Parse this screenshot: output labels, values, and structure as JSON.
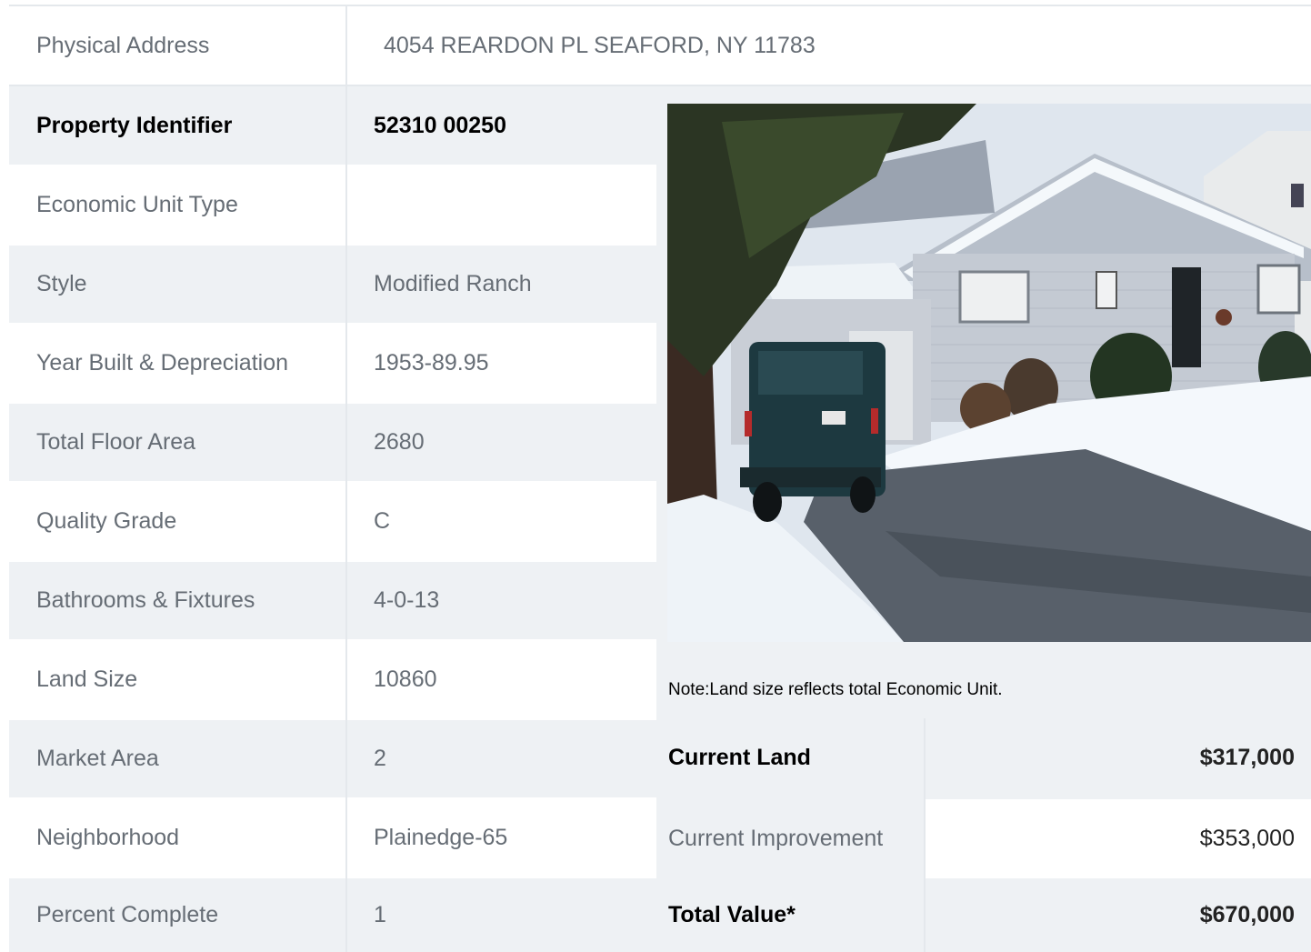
{
  "header": {
    "label": "Physical Address",
    "value": "4054  REARDON PL  SEAFORD, NY  11783"
  },
  "rows": [
    {
      "label": "Property Identifier",
      "value": "52310  00250",
      "bold": true
    },
    {
      "label": "Economic Unit Type",
      "value": ""
    },
    {
      "label": "Style",
      "value": "Modified Ranch"
    },
    {
      "label": "Year Built & Depreciation",
      "value": "1953-89.95"
    },
    {
      "label": "Total Floor Area",
      "value": "2680"
    },
    {
      "label": "Quality Grade",
      "value": "C"
    },
    {
      "label": "Bathrooms & Fixtures",
      "value": "4-0-13"
    },
    {
      "label": "Land Size",
      "value": "10860"
    },
    {
      "label": "Market Area",
      "value": "2"
    },
    {
      "label": "Neighborhood",
      "value": "Plainedge-65"
    },
    {
      "label": "Percent Complete",
      "value": "1"
    }
  ],
  "note": "Note:Land size reflects total Economic Unit.",
  "values": [
    {
      "label": "Current Land",
      "value": "$317,000",
      "bold": true
    },
    {
      "label": "Current Improvement",
      "value": "$353,000",
      "bold": false
    },
    {
      "label": "Total Value*",
      "value": "$670,000",
      "bold": true
    }
  ],
  "photo": {
    "subject": "house-photo"
  }
}
